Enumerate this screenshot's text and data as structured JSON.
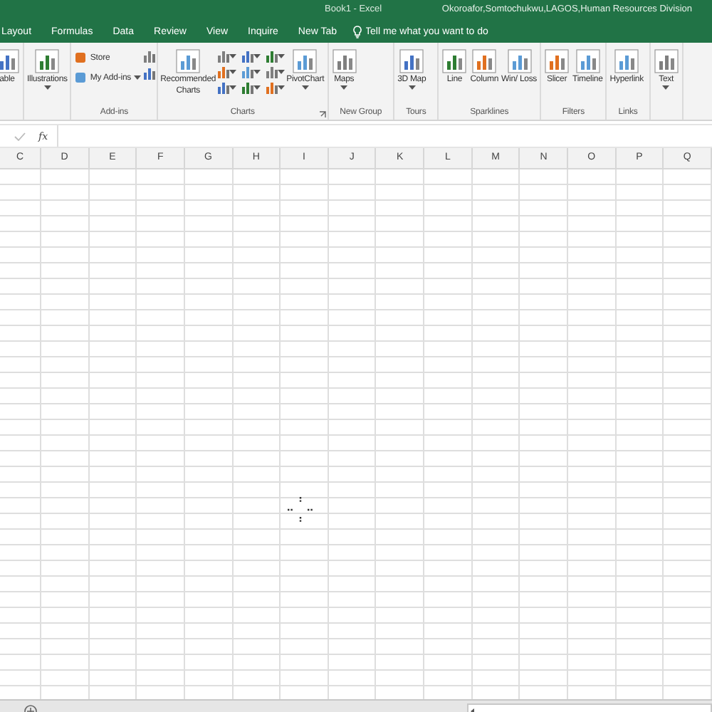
{
  "window": {
    "title": "Book1 - Excel",
    "user": "Okoroafor,Somtochukwu,LAGOS,Human Resources Division"
  },
  "tabs": [
    {
      "label": "Layout",
      "selected": false
    },
    {
      "label": "Formulas",
      "selected": false
    },
    {
      "label": "Data",
      "selected": false
    },
    {
      "label": "Review",
      "selected": false
    },
    {
      "label": "View",
      "selected": false
    },
    {
      "label": "Inquire",
      "selected": false
    },
    {
      "label": "New Tab",
      "selected": false
    }
  ],
  "tell_me": {
    "placeholder": "Tell me what you want to do"
  },
  "ribbon_groups": [
    {
      "items": [
        {
          "kind": "large",
          "label": "able",
          "dropdown": false
        }
      ]
    },
    {
      "items": [
        {
          "kind": "large",
          "label": "Illustrations",
          "dropdown": true
        }
      ]
    },
    {
      "label": "Add-ins",
      "items": [
        {
          "kind": "small",
          "label": "Store",
          "dropdown": false
        },
        {
          "kind": "small",
          "label": "My Add-ins",
          "dropdown": true
        },
        {
          "kind": "icon",
          "dropdown": false
        },
        {
          "kind": "icon",
          "dropdown": false
        }
      ]
    },
    {
      "label": "Charts",
      "launcher": true,
      "items": [
        {
          "kind": "large",
          "label": "Recommended Charts",
          "dropdown": false
        },
        {
          "kind": "icon",
          "dropdown": true
        },
        {
          "kind": "icon",
          "dropdown": true
        },
        {
          "kind": "icon",
          "dropdown": true
        },
        {
          "kind": "icon",
          "dropdown": true
        },
        {
          "kind": "icon",
          "dropdown": true
        },
        {
          "kind": "icon",
          "dropdown": true
        },
        {
          "kind": "icon",
          "dropdown": true
        },
        {
          "kind": "icon",
          "dropdown": true
        },
        {
          "kind": "icon",
          "dropdown": true
        },
        {
          "kind": "large",
          "label": "PivotChart",
          "dropdown": true
        }
      ]
    },
    {
      "label": "New Group",
      "items": [
        {
          "kind": "large",
          "label": "Maps",
          "dropdown": true
        }
      ]
    },
    {
      "label": "Tours",
      "items": [
        {
          "kind": "large",
          "label": "3D Map",
          "dropdown": true
        }
      ]
    },
    {
      "label": "Sparklines",
      "items": [
        {
          "kind": "large",
          "label": "Line",
          "dropdown": false
        },
        {
          "kind": "large",
          "label": "Column",
          "dropdown": false
        },
        {
          "kind": "large",
          "label": "Win/ Loss",
          "dropdown": false
        }
      ]
    },
    {
      "label": "Filters",
      "items": [
        {
          "kind": "large",
          "label": "Slicer",
          "dropdown": false
        },
        {
          "kind": "large",
          "label": "Timeline",
          "dropdown": false
        }
      ]
    },
    {
      "label": "Links",
      "items": [
        {
          "kind": "large",
          "label": "Hyperlink",
          "dropdown": false
        }
      ]
    },
    {
      "items": [
        {
          "kind": "large",
          "label": "Text",
          "dropdown": true
        }
      ]
    }
  ],
  "formula_bar": {
    "function_label": "fx"
  },
  "columns": [
    "C",
    "D",
    "E",
    "F",
    "G",
    "H",
    "I",
    "J",
    "K",
    "L",
    "M",
    "N",
    "O",
    "P",
    "Q"
  ]
}
